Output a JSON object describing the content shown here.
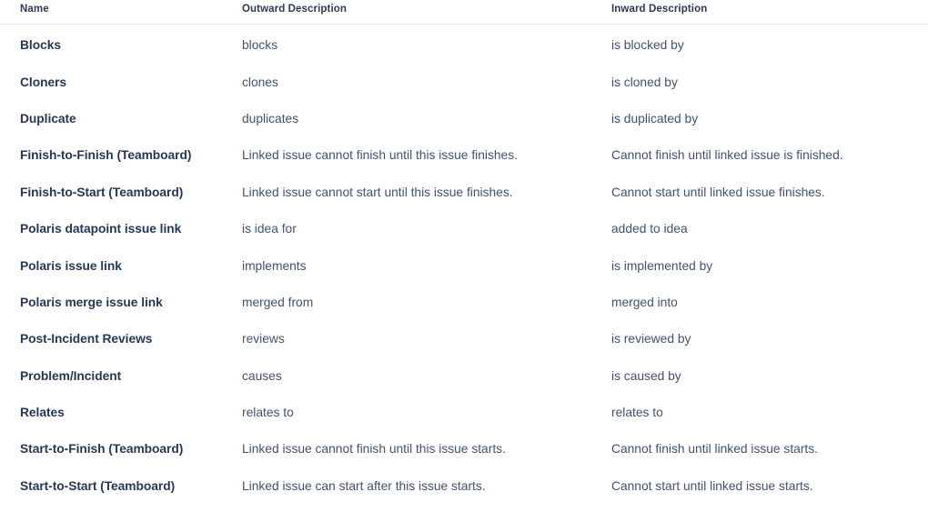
{
  "table": {
    "columns": [
      {
        "key": "name",
        "label": "Name"
      },
      {
        "key": "outward",
        "label": "Outward Description"
      },
      {
        "key": "inward",
        "label": "Inward Description"
      }
    ],
    "rows": [
      {
        "name": "Blocks",
        "outward": "blocks",
        "inward": "is blocked by"
      },
      {
        "name": "Cloners",
        "outward": "clones",
        "inward": "is cloned by"
      },
      {
        "name": "Duplicate",
        "outward": "duplicates",
        "inward": "is duplicated by"
      },
      {
        "name": "Finish-to-Finish (Teamboard)",
        "outward": "Linked issue cannot finish until this issue finishes.",
        "inward": "Cannot finish until linked issue is finished."
      },
      {
        "name": "Finish-to-Start (Teamboard)",
        "outward": "Linked issue cannot start until this issue finishes.",
        "inward": "Cannot start until linked issue finishes."
      },
      {
        "name": "Polaris datapoint issue link",
        "outward": "is idea for",
        "inward": "added to idea"
      },
      {
        "name": "Polaris issue link",
        "outward": "implements",
        "inward": "is implemented by"
      },
      {
        "name": "Polaris merge issue link",
        "outward": "merged from",
        "inward": "merged into"
      },
      {
        "name": "Post-Incident Reviews",
        "outward": "reviews",
        "inward": "is reviewed by"
      },
      {
        "name": "Problem/Incident",
        "outward": "causes",
        "inward": "is caused by"
      },
      {
        "name": "Relates",
        "outward": "relates to",
        "inward": "relates to"
      },
      {
        "name": "Start-to-Finish (Teamboard)",
        "outward": "Linked issue cannot finish until this issue starts.",
        "inward": "Cannot finish until linked issue starts."
      },
      {
        "name": "Start-to-Start (Teamboard)",
        "outward": "Linked issue can start after this issue starts.",
        "inward": "Cannot start until linked issue starts."
      }
    ]
  },
  "colors": {
    "page_background": "#ffffff",
    "header_text": "#2b3a55",
    "name_text": "#253858",
    "description_text": "#42526e",
    "header_rule": "#e6e8ec"
  }
}
